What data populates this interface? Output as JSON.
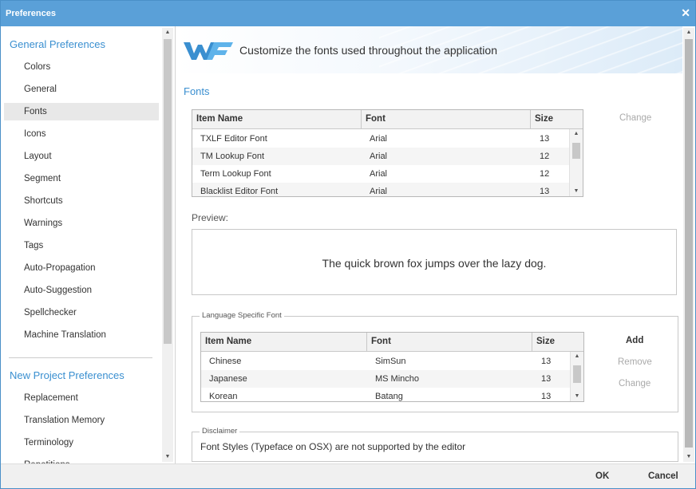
{
  "window": {
    "title": "Preferences",
    "close_glyph": "✕"
  },
  "sidebar": {
    "general_heading": "General Preferences",
    "general_items": [
      {
        "label": "Colors"
      },
      {
        "label": "General"
      },
      {
        "label": "Fonts"
      },
      {
        "label": "Icons"
      },
      {
        "label": "Layout"
      },
      {
        "label": "Segment"
      },
      {
        "label": "Shortcuts"
      },
      {
        "label": "Warnings"
      },
      {
        "label": "Tags"
      },
      {
        "label": "Auto-Propagation"
      },
      {
        "label": "Auto-Suggestion"
      },
      {
        "label": "Spellchecker"
      },
      {
        "label": "Machine Translation"
      }
    ],
    "active_item": "Fonts",
    "project_heading": "New Project Preferences",
    "project_items": [
      {
        "label": "Replacement"
      },
      {
        "label": "Translation Memory"
      },
      {
        "label": "Terminology"
      },
      {
        "label": "Repetitions"
      }
    ]
  },
  "banner": {
    "tagline": "Customize the fonts used throughout the application",
    "logo_icon": "wordfast-logo-icon"
  },
  "fonts_section": {
    "title": "Fonts",
    "columns": [
      "Item Name",
      "Font",
      "Size"
    ],
    "rows": [
      {
        "name": "TXLF Editor Font",
        "font": "Arial",
        "size": "13"
      },
      {
        "name": "TM Lookup Font",
        "font": "Arial",
        "size": "12"
      },
      {
        "name": "Term Lookup Font",
        "font": "Arial",
        "size": "12"
      },
      {
        "name": "Blacklist Editor Font",
        "font": "Arial",
        "size": "13"
      }
    ],
    "change_label": "Change"
  },
  "preview": {
    "label": "Preview:",
    "text": "The quick brown fox jumps over the lazy dog."
  },
  "language_specific": {
    "legend": "Language Specific Font",
    "columns": [
      "Item Name",
      "Font",
      "Size"
    ],
    "rows": [
      {
        "name": "Chinese",
        "font": "SimSun",
        "size": "13"
      },
      {
        "name": "Japanese",
        "font": "MS Mincho",
        "size": "13"
      },
      {
        "name": "Korean",
        "font": "Batang",
        "size": "13"
      }
    ],
    "add_label": "Add",
    "remove_label": "Remove",
    "change_label": "Change"
  },
  "disclaimer": {
    "legend": "Disclaimer",
    "text": "Font Styles (Typeface on OSX) are not supported by the editor"
  },
  "footer": {
    "ok_label": "OK",
    "cancel_label": "Cancel"
  },
  "colors": {
    "accent": "#3a8fd0",
    "titlebar": "#5aa0d8"
  }
}
